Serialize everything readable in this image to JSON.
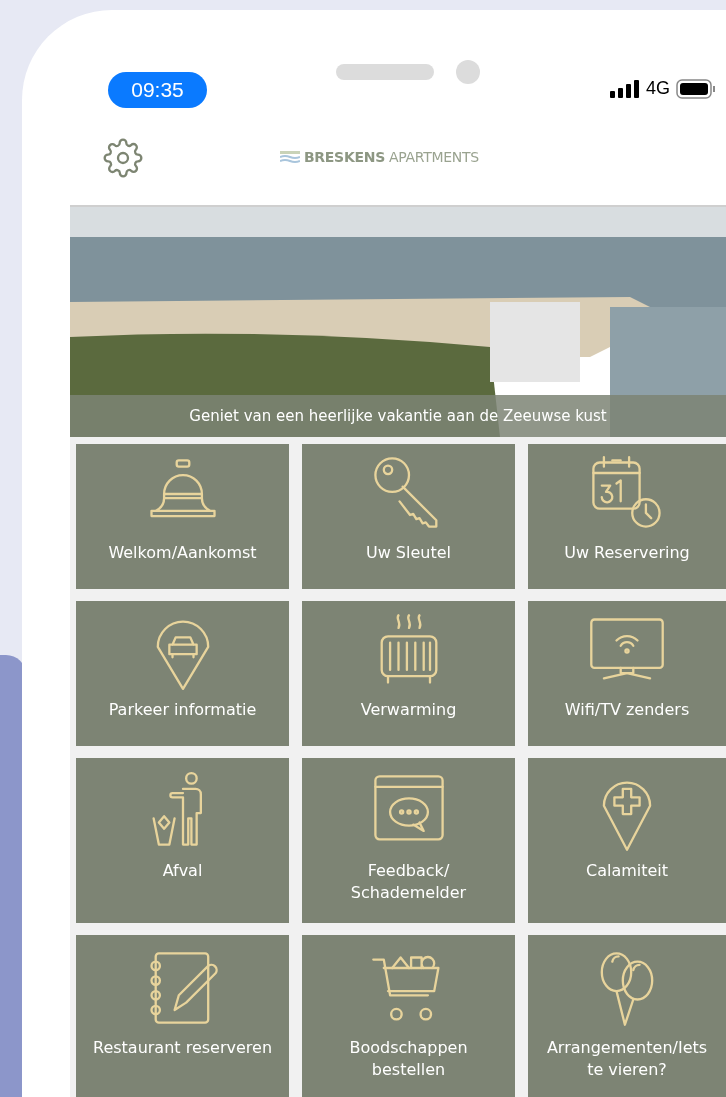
{
  "status_bar": {
    "time": "09:35",
    "network": "4G"
  },
  "header": {
    "logo_bold": "BRESKENS",
    "logo_light": "APARTMENTS"
  },
  "banner": {
    "caption": "Geniet van een heerlijke vakantie aan de Zeeuwse kust"
  },
  "tiles": [
    {
      "label": "Welkom/Aankomst"
    },
    {
      "label": "Uw Sleutel"
    },
    {
      "label": "Uw Reservering"
    },
    {
      "label": "Parkeer informatie"
    },
    {
      "label": "Verwarming"
    },
    {
      "label": "Wifi/TV zenders"
    },
    {
      "label": "Afval"
    },
    {
      "label": "Feedback/\nSchademelder"
    },
    {
      "label": "Calamiteit"
    },
    {
      "label": "Restaurant reserveren"
    },
    {
      "label": "Boodschappen\nbestellen"
    },
    {
      "label": "Arrangementen/Iets\nte vieren?"
    }
  ]
}
